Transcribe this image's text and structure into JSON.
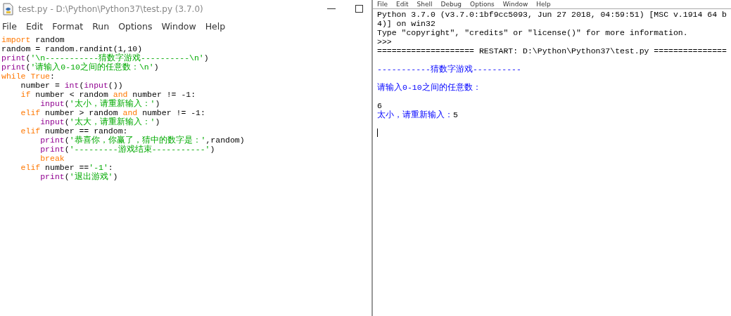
{
  "editor": {
    "title": "test.py - D:\\Python\\Python37\\test.py (3.7.0)",
    "menu": [
      "File",
      "Edit",
      "Format",
      "Run",
      "Options",
      "Window",
      "Help"
    ],
    "code": [
      [
        {
          "kind": "keyword",
          "text": "import"
        },
        {
          "kind": "plain",
          "text": " random"
        }
      ],
      [
        {
          "kind": "plain",
          "text": "random = random.randint(1,10)"
        }
      ],
      [
        {
          "kind": "builtin",
          "text": "print"
        },
        {
          "kind": "plain",
          "text": "("
        },
        {
          "kind": "string",
          "text": "'\\n-----------猜数字游戏----------\\n'"
        },
        {
          "kind": "plain",
          "text": ")"
        }
      ],
      [
        {
          "kind": "builtin",
          "text": "print"
        },
        {
          "kind": "plain",
          "text": "("
        },
        {
          "kind": "string",
          "text": "'请输入0-10之间的任意数：\\n'"
        },
        {
          "kind": "plain",
          "text": ")"
        }
      ],
      [
        {
          "kind": "keyword",
          "text": "while True"
        },
        {
          "kind": "plain",
          "text": ":"
        }
      ],
      [
        {
          "kind": "plain",
          "text": "    number = "
        },
        {
          "kind": "builtin",
          "text": "int"
        },
        {
          "kind": "plain",
          "text": "("
        },
        {
          "kind": "builtin",
          "text": "input"
        },
        {
          "kind": "plain",
          "text": "())"
        }
      ],
      [
        {
          "kind": "keyword",
          "text": "    if"
        },
        {
          "kind": "plain",
          "text": " number < random "
        },
        {
          "kind": "keyword",
          "text": "and"
        },
        {
          "kind": "plain",
          "text": " number != -1:"
        }
      ],
      [
        {
          "kind": "builtin",
          "text": "        input"
        },
        {
          "kind": "plain",
          "text": "("
        },
        {
          "kind": "string",
          "text": "'太小，请重新输入：'"
        },
        {
          "kind": "plain",
          "text": ")"
        }
      ],
      [
        {
          "kind": "keyword",
          "text": "    elif"
        },
        {
          "kind": "plain",
          "text": " number > random "
        },
        {
          "kind": "keyword",
          "text": "and"
        },
        {
          "kind": "plain",
          "text": " number != -1:"
        }
      ],
      [
        {
          "kind": "builtin",
          "text": "        input"
        },
        {
          "kind": "plain",
          "text": "("
        },
        {
          "kind": "string",
          "text": "'太大，请重新输入：'"
        },
        {
          "kind": "plain",
          "text": ")"
        }
      ],
      [
        {
          "kind": "keyword",
          "text": "    elif"
        },
        {
          "kind": "plain",
          "text": " number == random:"
        }
      ],
      [
        {
          "kind": "builtin",
          "text": "        print"
        },
        {
          "kind": "plain",
          "text": "("
        },
        {
          "kind": "string",
          "text": "'恭喜你，你赢了，猜中的数字是：'"
        },
        {
          "kind": "plain",
          "text": ",random)"
        }
      ],
      [
        {
          "kind": "builtin",
          "text": "        print"
        },
        {
          "kind": "plain",
          "text": "("
        },
        {
          "kind": "string",
          "text": "'---------游戏结束-----------'"
        },
        {
          "kind": "plain",
          "text": ")"
        }
      ],
      [
        {
          "kind": "keyword",
          "text": "        break"
        }
      ],
      [
        {
          "kind": "keyword",
          "text": "    elif"
        },
        {
          "kind": "plain",
          "text": " number =="
        },
        {
          "kind": "string",
          "text": "'-1'"
        },
        {
          "kind": "plain",
          "text": ":"
        }
      ],
      [
        {
          "kind": "builtin",
          "text": "        print"
        },
        {
          "kind": "plain",
          "text": "("
        },
        {
          "kind": "string",
          "text": "'退出游戏'"
        },
        {
          "kind": "plain",
          "text": ")"
        }
      ]
    ]
  },
  "shell": {
    "menu": [
      "File",
      "Edit",
      "Shell",
      "Debug",
      "Options",
      "Window",
      "Help"
    ],
    "blocks": [
      [
        [
          {
            "kind": "plain",
            "text": "Python 3.7.0 (v3.7.0:1bf9cc5093, Jun 27 2018, 04:59:51) [MSC v.1914 64 b"
          }
        ],
        [
          {
            "kind": "plain",
            "text": "4)] on win32"
          }
        ],
        [
          {
            "kind": "plain",
            "text": "Type \"copyright\", \"credits\" or \"license()\" for more information."
          }
        ],
        [
          {
            "kind": "plain",
            "text": ">>>"
          }
        ],
        [
          {
            "kind": "plain",
            "text": "==================== RESTART: D:\\Python\\Python37\\test.py ==============="
          }
        ]
      ],
      [
        [
          {
            "kind": "stdout",
            "text": "-----------猜数字游戏----------"
          }
        ]
      ],
      [
        [
          {
            "kind": "stdout",
            "text": "请输入0-10之间的任意数："
          }
        ]
      ],
      [
        [
          {
            "kind": "stdin",
            "text": "6"
          }
        ],
        [
          {
            "kind": "stdout",
            "text": "太小，请重新输入："
          },
          {
            "kind": "stdin",
            "text": "5"
          }
        ]
      ]
    ]
  }
}
